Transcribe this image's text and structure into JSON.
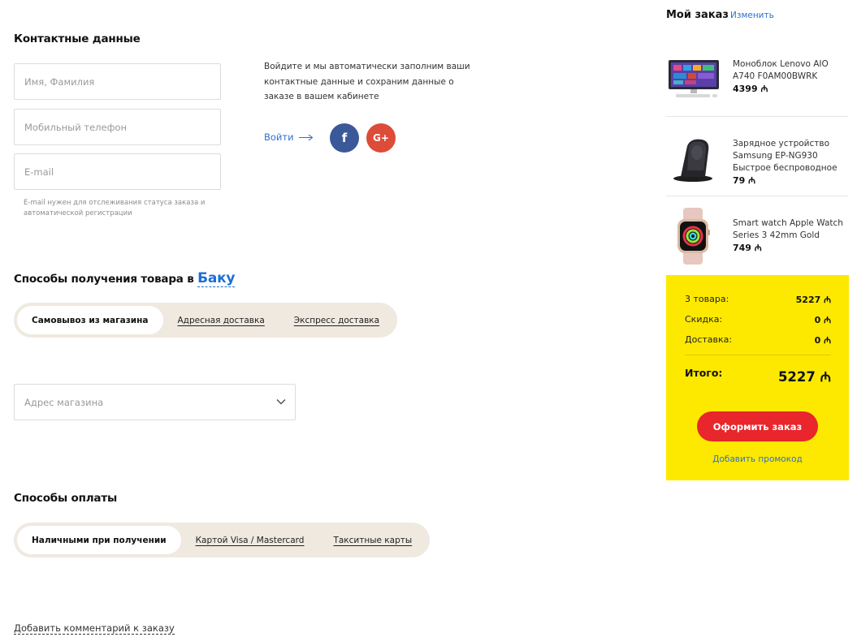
{
  "contacts": {
    "title": "Контактные данные",
    "name_placeholder": "Имя, Фамилия",
    "phone_placeholder": "Мобильный телефон",
    "email_placeholder": "E-mail",
    "email_hint": "E-mail нужен для отслеживания статуса заказа и автоматической регистрации",
    "login_text": "Войдите и мы автоматически заполним ваши контактные данные и сохраним данные о заказе в вашем кабинете",
    "login_link": "Войти",
    "facebook_glyph": "f",
    "google_glyph": "G+"
  },
  "delivery": {
    "title_prefix": "Способы получения товара в",
    "city": "Баку",
    "options": [
      "Самовывоз из магазина",
      "Адресная доставка",
      "Экспресс доставка"
    ],
    "active_index": 0,
    "store_placeholder": "Адрес магазина"
  },
  "payment": {
    "title": "Способы оплаты",
    "options": [
      "Наличными при получении",
      "Картой Visa / Mastercard",
      "Такситные карты"
    ],
    "active_index": 0
  },
  "comment_link": "Добавить комментарий к заказу",
  "order": {
    "title": "Мой заказ",
    "edit_label": "Изменить",
    "items": [
      {
        "name": "Моноблок Lenovo AIO A740 F0AM00BWRK",
        "price": "4399 ₼",
        "icon": "monitor-icon"
      },
      {
        "name": "Зарядное устройство Samsung EP-NG930 Быстрое беспроводное",
        "price": "79 ₼",
        "icon": "charger-icon"
      },
      {
        "name": "Smart watch Apple Watch Series 3 42mm Gold",
        "price": "749 ₼",
        "icon": "watch-icon"
      }
    ],
    "summary": {
      "items_label": "3 товара:",
      "items_value": "5227 ₼",
      "discount_label": "Скидка:",
      "discount_value": "0 ₼",
      "delivery_label": "Доставка:",
      "delivery_value": "0 ₼",
      "total_label": "Итого:",
      "total_value": "5227 ₼",
      "checkout_label": "Оформить заказ",
      "promo_label": "Добавить промокод"
    }
  },
  "colors": {
    "accent_blue": "#2f6fd1",
    "summary_bg": "#fde900",
    "checkout_red": "#e8262b",
    "segment_bg": "#efe9e0"
  }
}
